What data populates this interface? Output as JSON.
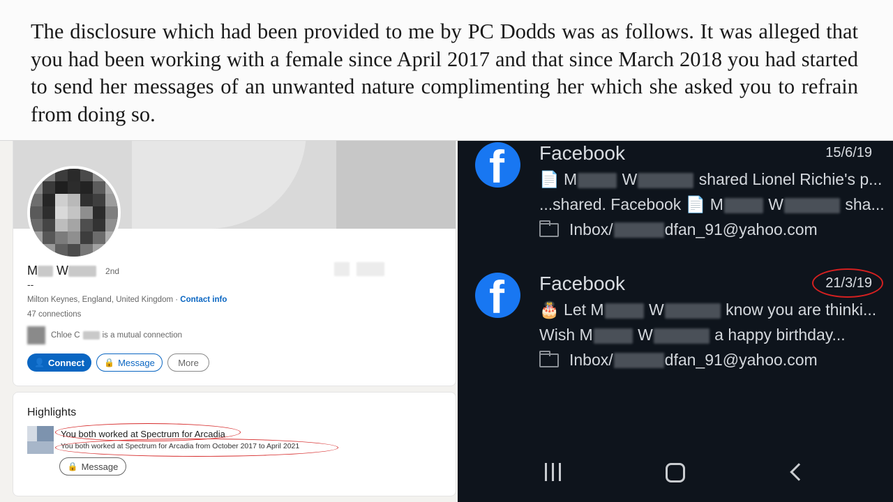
{
  "document": {
    "text": "The disclosure which had been provided to me by PC Dodds was as follows. It was alleged that you had been working with a female since April 2017 and that since March 2018 you had started to send her messages of an unwanted nature complimenting her which she asked you to refrain from doing so."
  },
  "linkedin": {
    "name_first_initial": "M",
    "name_last_initial": "W",
    "degree": "2nd",
    "headline": "--",
    "location": "Milton Keynes, England, United Kingdom",
    "location_separator": " · ",
    "contact_info": "Contact info",
    "connections": "47 connections",
    "mutual_name": "Chloe C",
    "mutual_text": "is a mutual connection",
    "buttons": {
      "connect": "Connect",
      "message": "Message",
      "more": "More"
    },
    "highlights": {
      "title": "Highlights",
      "line1": "You both worked at Spectrum for Arcadia",
      "line2": "You both worked at Spectrum for Arcadia from October 2017 to April 2021",
      "message_button": "Message"
    },
    "colors": {
      "brand": "#0a66c2",
      "annotation": "#d62b2b"
    }
  },
  "email": {
    "items": [
      {
        "sender": "Facebook",
        "date": "15/6/19",
        "line1_prefix": "📄 M",
        "line1_mid": "W",
        "line1_suffix": "shared Lionel Richie's p...",
        "line2_prefix": "...shared. Facebook 📄 M",
        "line2_mid": "W",
        "line2_suffix": "sha...",
        "folder_prefix": "Inbox/",
        "folder_suffix": "dfan_91@yahoo.com"
      },
      {
        "sender": "Facebook",
        "date": "21/3/19",
        "line1_prefix": "🎂 Let M",
        "line1_mid": "W",
        "line1_suffix": "know you are thinki...",
        "line2_prefix": "Wish M",
        "line2_mid": "W",
        "line2_suffix": "a happy birthday...",
        "folder_prefix": "Inbox/",
        "folder_suffix": "dfan_91@yahoo.com"
      }
    ],
    "logo_glyph": "f",
    "colors": {
      "background": "#0e141c",
      "facebook_blue": "#1877f2",
      "annotation": "#d42020"
    }
  },
  "icons": {
    "lock": "🔒",
    "person_add": "👤"
  }
}
